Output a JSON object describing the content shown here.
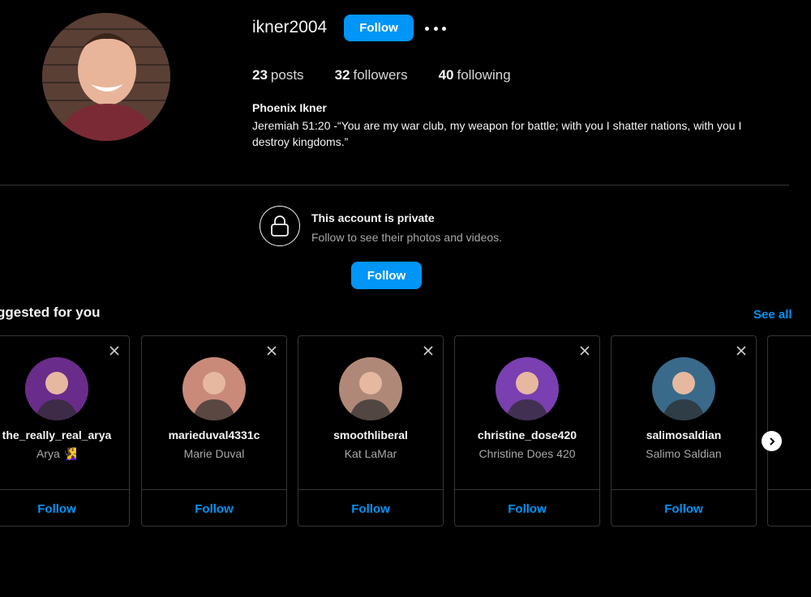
{
  "profile": {
    "username": "ikner2004",
    "follow_label": "Follow",
    "posts_count": "23",
    "posts_label": "posts",
    "followers_count": "32",
    "followers_label": "followers",
    "following_count": "40",
    "following_label": "following",
    "full_name": "Phoenix Ikner",
    "bio": "Jeremiah 51:20 -“You are my war club, my weapon for battle; with you I shatter nations, with you I destroy kingdoms.”"
  },
  "private_notice": {
    "title": "This account is private",
    "subtitle": "Follow to see their photos and videos.",
    "follow_label": "Follow",
    "icon": "lock-icon"
  },
  "suggestions": {
    "title": "ggested for you",
    "see_all": "See all",
    "follow_label": "Follow",
    "cards": [
      {
        "username": "the_really_real_arya",
        "display_name": "Arya 🧏‍♀️",
        "avatar_color": "#6a2c8a"
      },
      {
        "username": "marieduval4331c",
        "display_name": "Marie Duval",
        "avatar_color": "#c98a7a"
      },
      {
        "username": "smoothliberal",
        "display_name": "Kat LaMar",
        "avatar_color": "#b08878"
      },
      {
        "username": "christine_dose420",
        "display_name": "Christine Does 420",
        "avatar_color": "#7a3fb0"
      },
      {
        "username": "salimosaldian",
        "display_name": "Salimo Saldian",
        "avatar_color": "#3a6a8a"
      }
    ]
  },
  "colors": {
    "accent": "#0095f6",
    "background": "#000000",
    "border": "#363636",
    "muted_text": "#a8a8a8"
  }
}
